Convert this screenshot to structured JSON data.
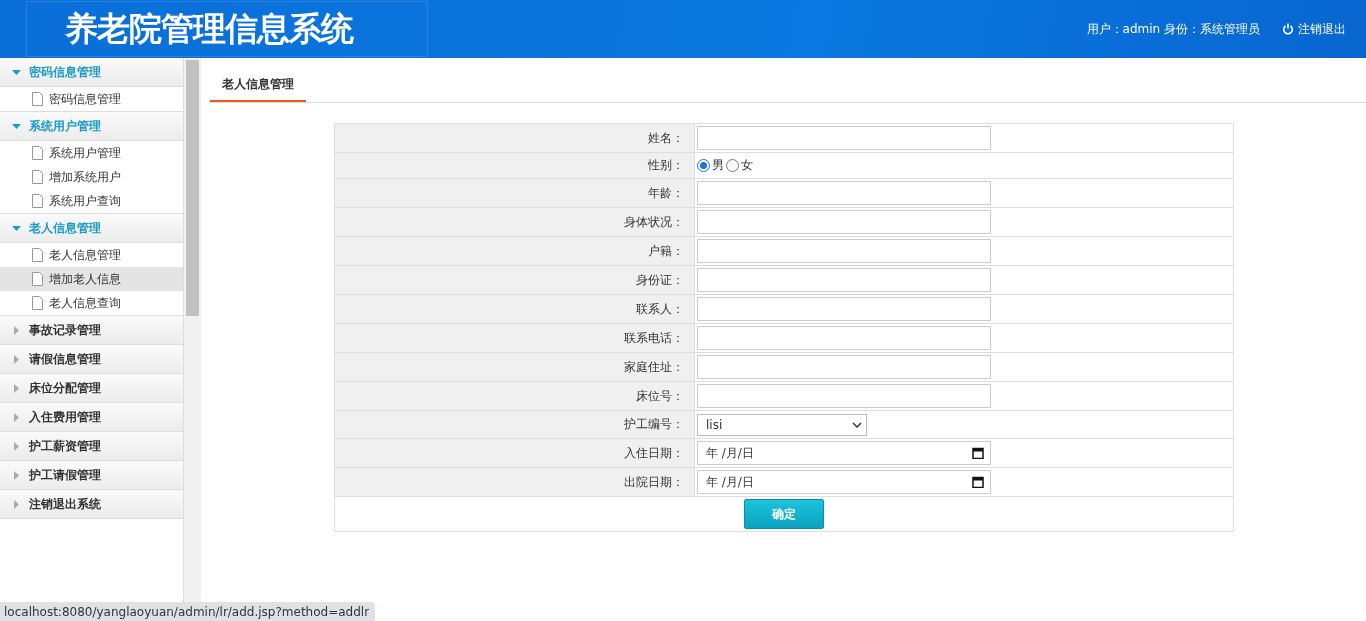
{
  "header": {
    "title": "养老院管理信息系统",
    "user_info": "用户：admin 身份：系统管理员",
    "logout": "注销退出"
  },
  "sidebar": {
    "groups": [
      {
        "label": "密码信息管理",
        "expanded": true,
        "items": [
          {
            "label": "密码信息管理",
            "selected": false
          }
        ]
      },
      {
        "label": "系统用户管理",
        "expanded": true,
        "items": [
          {
            "label": "系统用户管理",
            "selected": false
          },
          {
            "label": "增加系统用户",
            "selected": false
          },
          {
            "label": "系统用户查询",
            "selected": false
          }
        ]
      },
      {
        "label": "老人信息管理",
        "expanded": true,
        "items": [
          {
            "label": "老人信息管理",
            "selected": false
          },
          {
            "label": "增加老人信息",
            "selected": true
          },
          {
            "label": "老人信息查询",
            "selected": false
          }
        ]
      },
      {
        "label": "事故记录管理",
        "expanded": false
      },
      {
        "label": "请假信息管理",
        "expanded": false
      },
      {
        "label": "床位分配管理",
        "expanded": false
      },
      {
        "label": "入住费用管理",
        "expanded": false
      },
      {
        "label": "护工薪资管理",
        "expanded": false
      },
      {
        "label": "护工请假管理",
        "expanded": false
      },
      {
        "label": "注销退出系统",
        "expanded": false
      }
    ]
  },
  "tabs": [
    {
      "label": "老人信息管理",
      "selected": true
    }
  ],
  "form": {
    "fields": [
      {
        "kind": "text",
        "label": "姓名："
      },
      {
        "kind": "radio",
        "label": "性别：",
        "options": [
          {
            "label": "男",
            "selected": true
          },
          {
            "label": "女",
            "selected": false
          }
        ]
      },
      {
        "kind": "text",
        "label": "年龄："
      },
      {
        "kind": "text",
        "label": "身体状况："
      },
      {
        "kind": "text",
        "label": "户籍："
      },
      {
        "kind": "text",
        "label": "身份证："
      },
      {
        "kind": "text",
        "label": "联系人："
      },
      {
        "kind": "text",
        "label": "联系电话："
      },
      {
        "kind": "text",
        "label": "家庭住址："
      },
      {
        "kind": "text",
        "label": "床位号："
      },
      {
        "kind": "select",
        "label": "护工编号：",
        "value": "lisi"
      },
      {
        "kind": "date",
        "label": "入住日期：",
        "placeholder": "年 /月/日"
      },
      {
        "kind": "date",
        "label": "出院日期：",
        "placeholder": "年 /月/日"
      }
    ],
    "submit": "确定"
  },
  "status_bar": "localhost:8080/yanglaoyuan/admin/lr/add.jsp?method=addlr"
}
